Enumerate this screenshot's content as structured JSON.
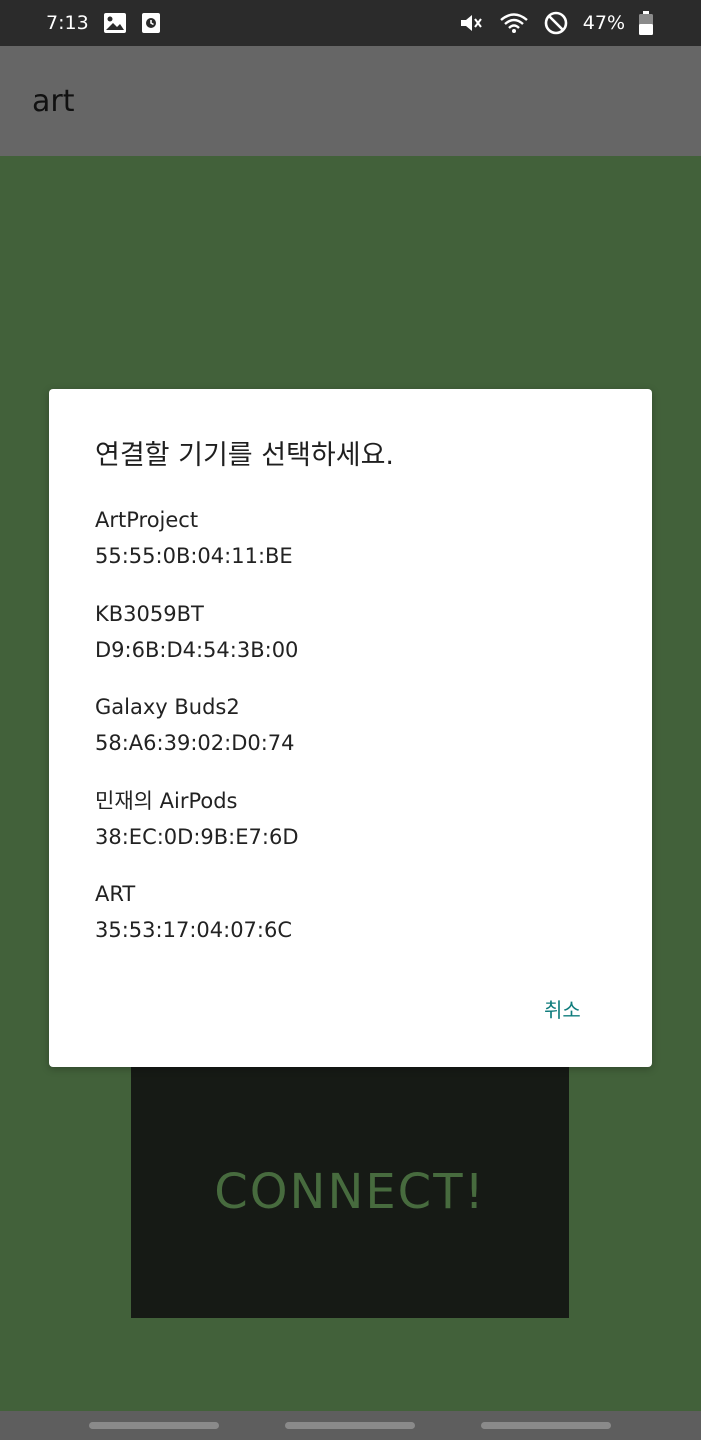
{
  "status_bar": {
    "time": "7:13",
    "left_icons": [
      "image-icon",
      "media-icon"
    ],
    "right_icons": [
      "mute-icon",
      "wifi-icon",
      "do-not-disturb-icon",
      "battery-icon"
    ],
    "battery": "47%"
  },
  "app_bar": {
    "title": "art"
  },
  "main": {
    "connect_label": "CONNECT!"
  },
  "dialog": {
    "title": "연결할 기기를 선택하세요.",
    "devices": [
      {
        "name": "ArtProject",
        "address": "55:55:0B:04:11:BE"
      },
      {
        "name": "KB3059BT",
        "address": "D9:6B:D4:54:3B:00"
      },
      {
        "name": "Galaxy Buds2",
        "address": "58:A6:39:02:D0:74"
      },
      {
        "name": "민재의 AirPods",
        "address": "38:EC:0D:9B:E7:6D"
      },
      {
        "name": "ART",
        "address": "35:53:17:04:07:6C"
      }
    ],
    "cancel_label": "취소"
  },
  "colors": {
    "status_bar": "#2b2b2b",
    "app_bar": "#666666",
    "background": "#42613a",
    "connect_panel": "#161a15",
    "connect_text": "#476b3e",
    "dialog_accent": "#0f7c7c",
    "nav_bar": "#5e5e5e"
  }
}
